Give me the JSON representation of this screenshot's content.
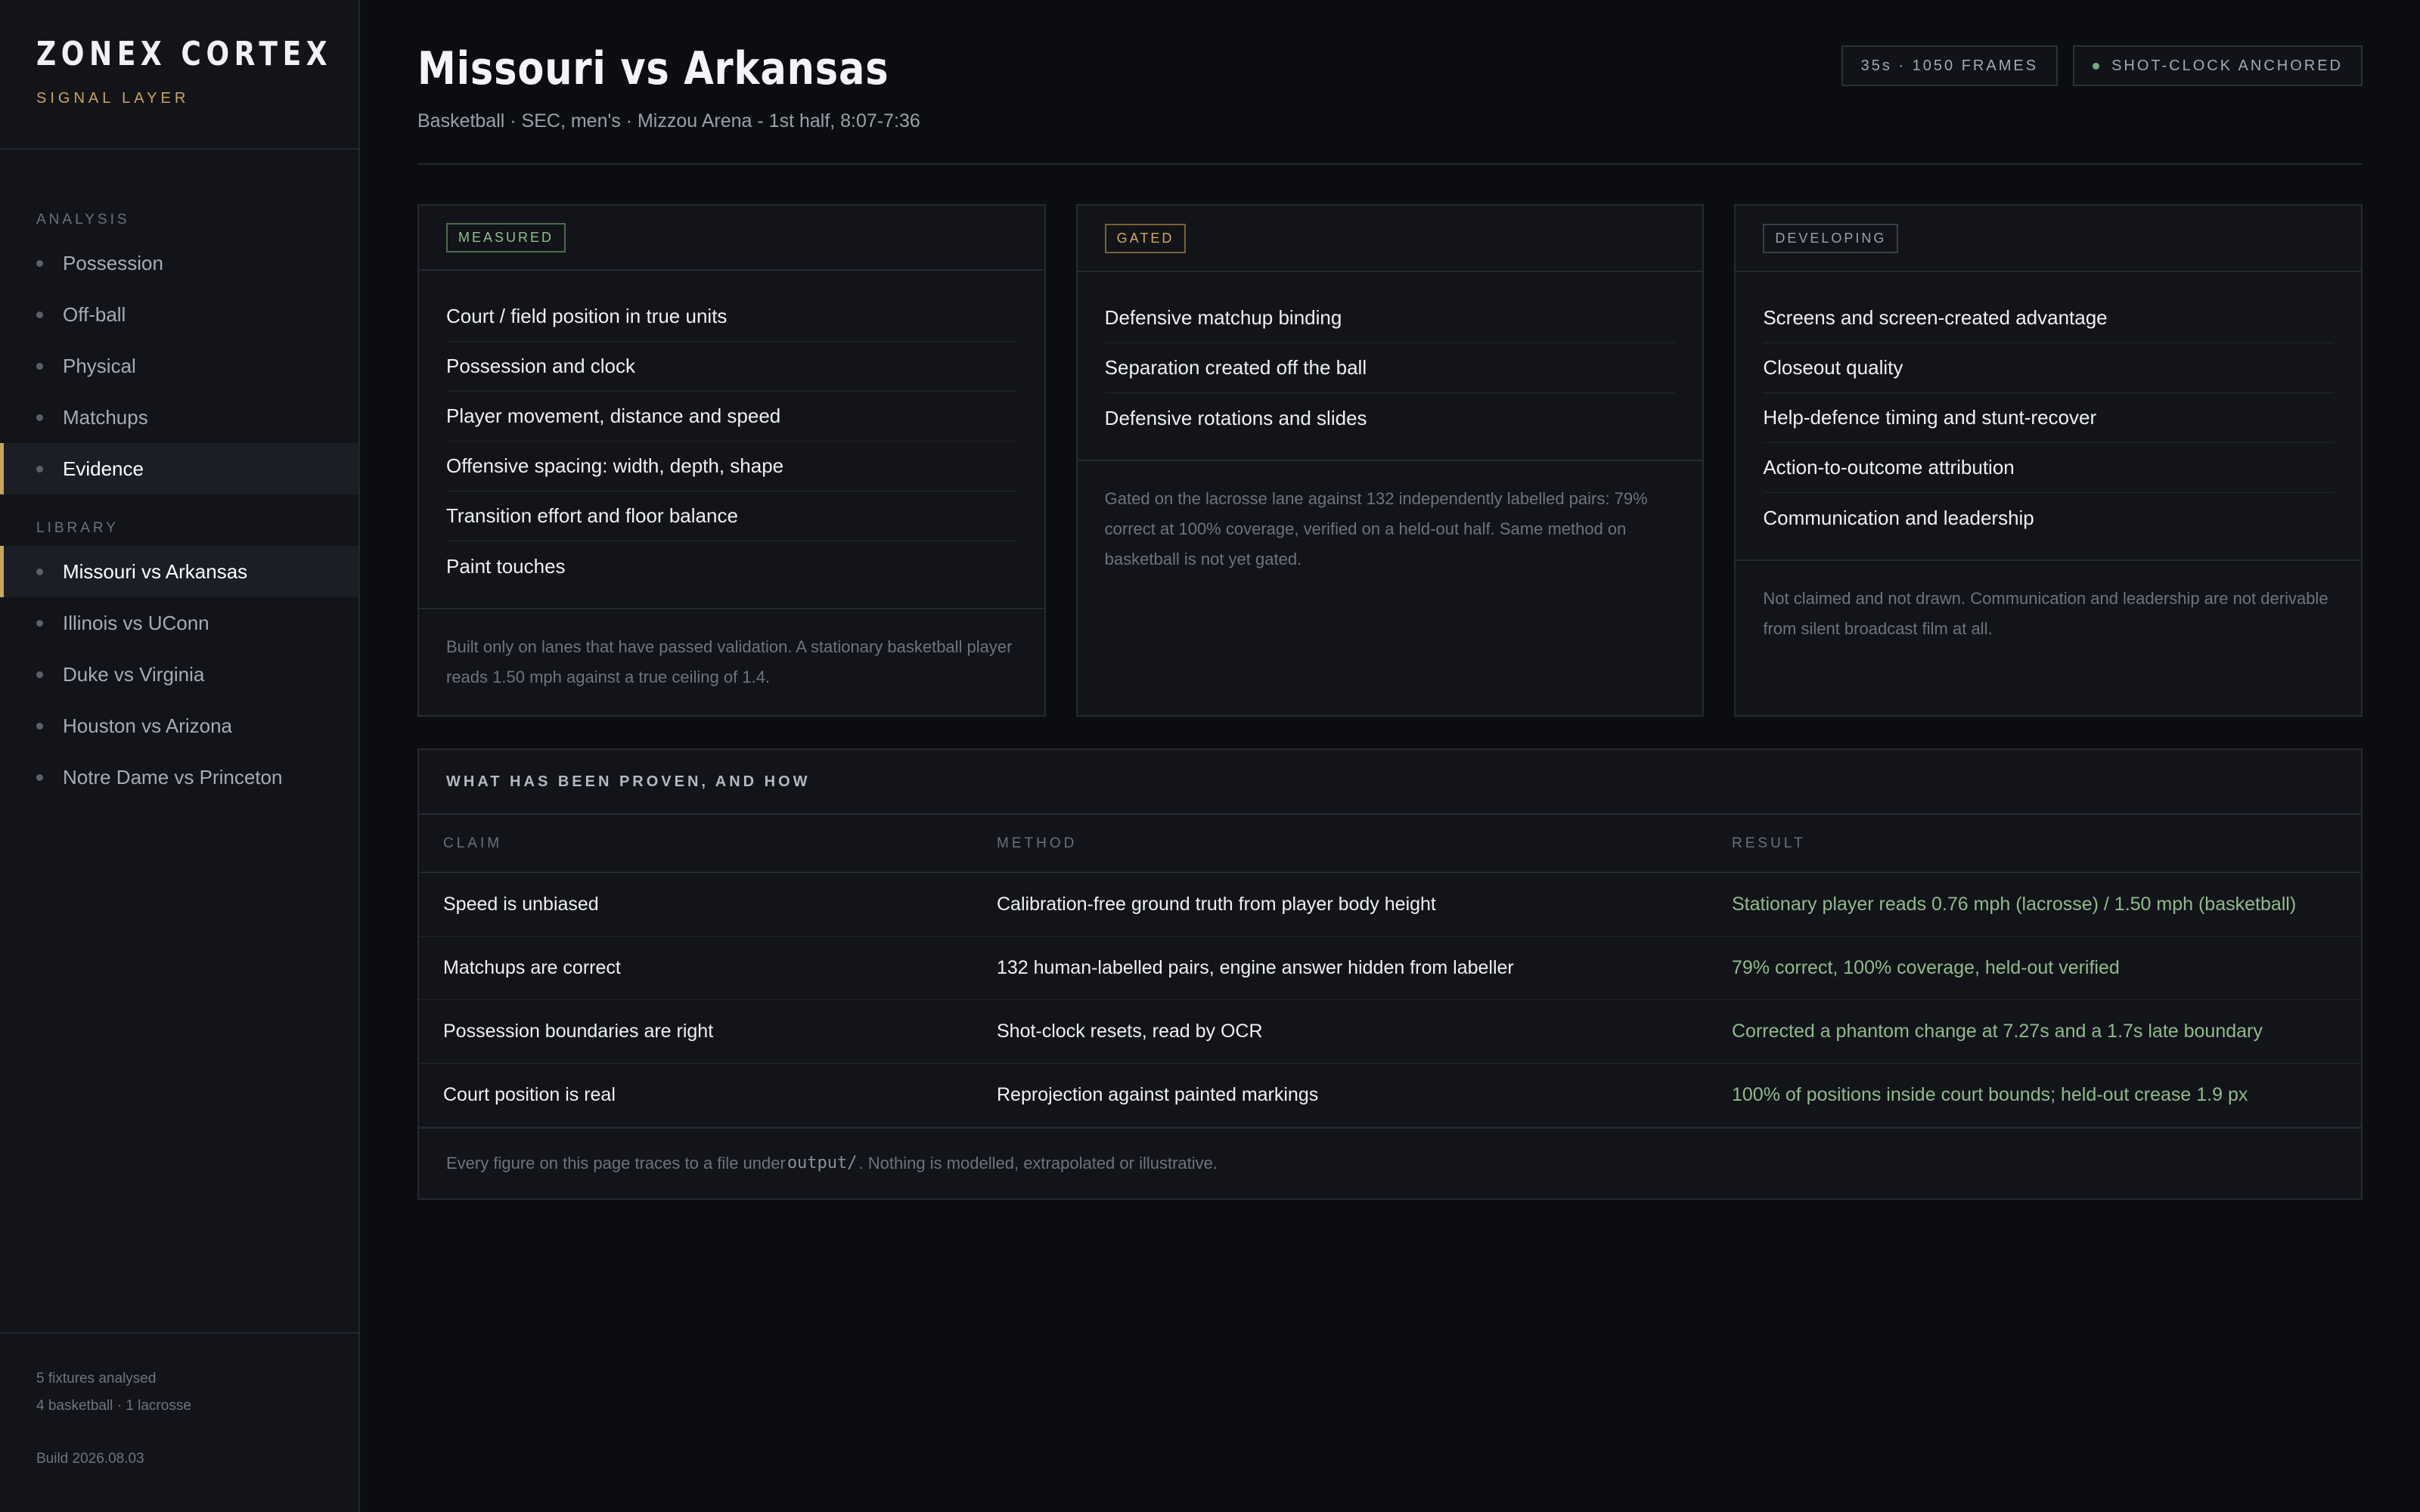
{
  "brand": {
    "title": "ZONEX CORTEX",
    "subtitle": "SIGNAL LAYER"
  },
  "nav": {
    "analysis_label": "ANALYSIS",
    "analysis_items": [
      "Possession",
      "Off-ball",
      "Physical",
      "Matchups",
      "Evidence"
    ],
    "active_analysis": "Evidence",
    "library_label": "LIBRARY",
    "library_items": [
      "Missouri vs Arkansas",
      "Illinois vs UConn",
      "Duke vs Virginia",
      "Houston vs Arizona",
      "Notre Dame vs Princeton"
    ],
    "active_library": "Missouri vs Arkansas"
  },
  "footer": {
    "fixtures": "5 fixtures analysed",
    "breakdown": "4 basketball · 1 lacrosse",
    "build": "Build 2026.08.03"
  },
  "header": {
    "title": "Missouri vs Arkansas",
    "subtitle": "Basketball · SEC, men's · Mizzou Arena - 1st half, 8:07-7:36",
    "frames_badge": "35s · 1050 FRAMES",
    "anchor_badge": "SHOT-CLOCK ANCHORED",
    "anchor_dot_color": "#6fae7c"
  },
  "cards": {
    "measured": {
      "tag": "MEASURED",
      "items": [
        "Court / field position in true units",
        "Possession and clock",
        "Player movement, distance and speed",
        "Offensive spacing: width, depth, shape",
        "Transition effort and floor balance",
        "Paint touches"
      ],
      "note": "Built only on lanes that have passed validation. A stationary basketball player reads 1.50 mph against a true ceiling of 1.4."
    },
    "gated": {
      "tag": "GATED",
      "items": [
        "Defensive matchup binding",
        "Separation created off the ball",
        "Defensive rotations and slides"
      ],
      "note": "Gated on the lacrosse lane against 132 independently labelled pairs: 79% correct at 100% coverage, verified on a held-out half. Same method on basketball is not yet gated."
    },
    "developing": {
      "tag": "DEVELOPING",
      "items": [
        "Screens and screen-created advantage",
        "Closeout quality",
        "Help-defence timing and stunt-recover",
        "Action-to-outcome attribution",
        "Communication and leadership"
      ],
      "note": "Not claimed and not drawn. Communication and leadership are not derivable from silent broadcast film at all."
    }
  },
  "proof": {
    "title": "WHAT HAS BEEN PROVEN, AND HOW",
    "columns": [
      "CLAIM",
      "METHOD",
      "RESULT"
    ],
    "rows": [
      {
        "claim": "Speed is unbiased",
        "method": "Calibration-free ground truth from player body height",
        "result": "Stationary player reads 0.76 mph (lacrosse) / 1.50 mph (basketball)"
      },
      {
        "claim": "Matchups are correct",
        "method": "132 human-labelled pairs, engine answer hidden from labeller",
        "result": "79% correct, 100% coverage, held-out verified"
      },
      {
        "claim": "Possession boundaries are right",
        "method": "Shot-clock resets, read by OCR",
        "result": "Corrected a phantom change at 7.27s and a 1.7s late boundary"
      },
      {
        "claim": "Court position is real",
        "method": "Reprojection against painted markings",
        "result": "100% of positions inside court bounds; held-out crease 1.9 px"
      }
    ],
    "footnote_pre": "Every figure on this page traces to a file under ",
    "footnote_code": "output/",
    "footnote_post": ". Nothing is modelled, extrapolated or illustrative."
  },
  "colors": {
    "accent": "#c9a55e",
    "measured": "#8fc08f",
    "gated": "#d4a85c",
    "result_green": "#8fbb8c",
    "background": "#0c0d11"
  }
}
